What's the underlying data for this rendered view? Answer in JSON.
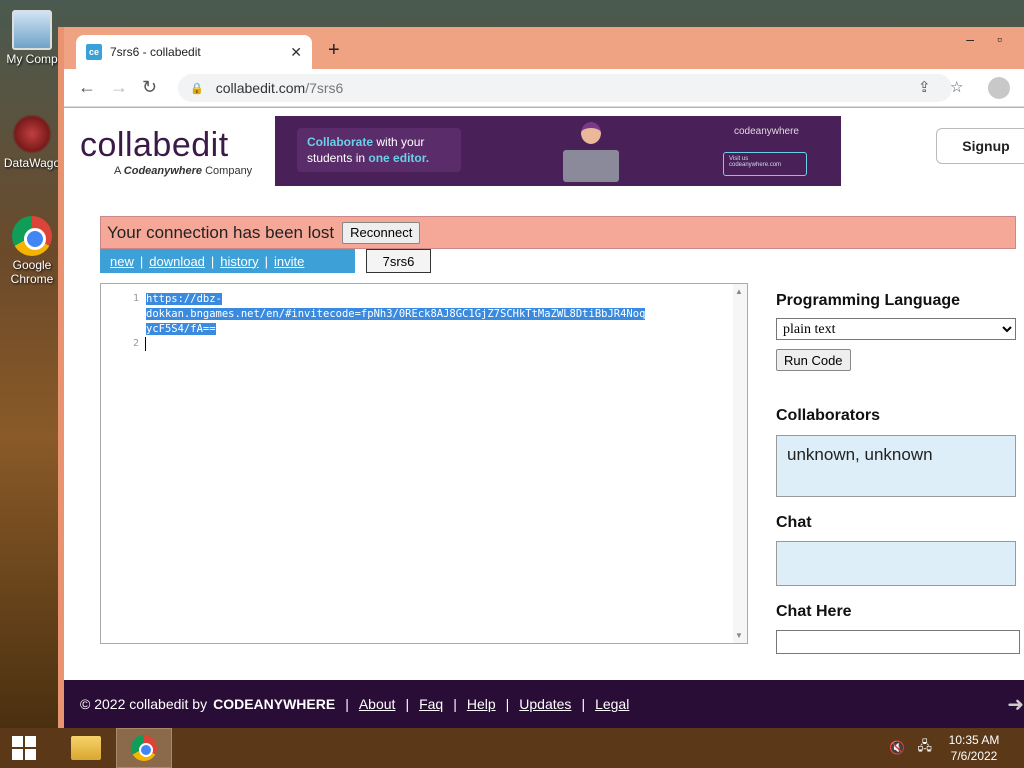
{
  "desktop": {
    "icons": [
      {
        "label": "My Comp"
      },
      {
        "label": "DataWago"
      },
      {
        "label": "Google Chrome"
      }
    ]
  },
  "browser": {
    "tab_title": "7srs6 - collabedit",
    "favicon_text": "ce",
    "url_host": "collabedit.com",
    "url_path": "/7srs6"
  },
  "site": {
    "logo_main": "collabedit",
    "logo_sub_prefix": "A",
    "logo_sub_brand": "Codeanywhere",
    "logo_sub_suffix": "Company",
    "banner": {
      "hl1": "Collaborate",
      "t1": "with your",
      "t2": "students in",
      "hl2": "one editor.",
      "brand": "codeanywhere",
      "visit": "Visit us",
      "visit_url": "codeanywhere.com"
    },
    "signup_label": "Signup"
  },
  "session": {
    "connection_message": "Your connection has been lost",
    "reconnect_label": "Reconnect",
    "links": [
      "new",
      "download",
      "history",
      "invite"
    ],
    "id": "7srs6"
  },
  "editor": {
    "lines": [
      "https://dbz-",
      "dokkan.bngames.net/en/#invitecode=fpNh3/0REck8AJ8GC1GjZ7SCHkTtMaZWL8DtiBbJR4Noq",
      "ycF5S4/fA=="
    ],
    "line_numbers": [
      "1",
      "2"
    ]
  },
  "sidebar": {
    "lang_heading": "Programming Language",
    "lang_selected": "plain text",
    "run_label": "Run Code",
    "collab_heading": "Collaborators",
    "collaborators": "unknown, unknown",
    "chat_heading": "Chat",
    "chat_here_heading": "Chat Here"
  },
  "footer": {
    "copyright": "© 2022 collabedit by",
    "brand": "CODEANYWHERE",
    "links": [
      "About",
      "Faq",
      "Help",
      "Updates",
      "Legal"
    ]
  },
  "taskbar": {
    "time": "10:35 AM",
    "date": "7/6/2022"
  }
}
